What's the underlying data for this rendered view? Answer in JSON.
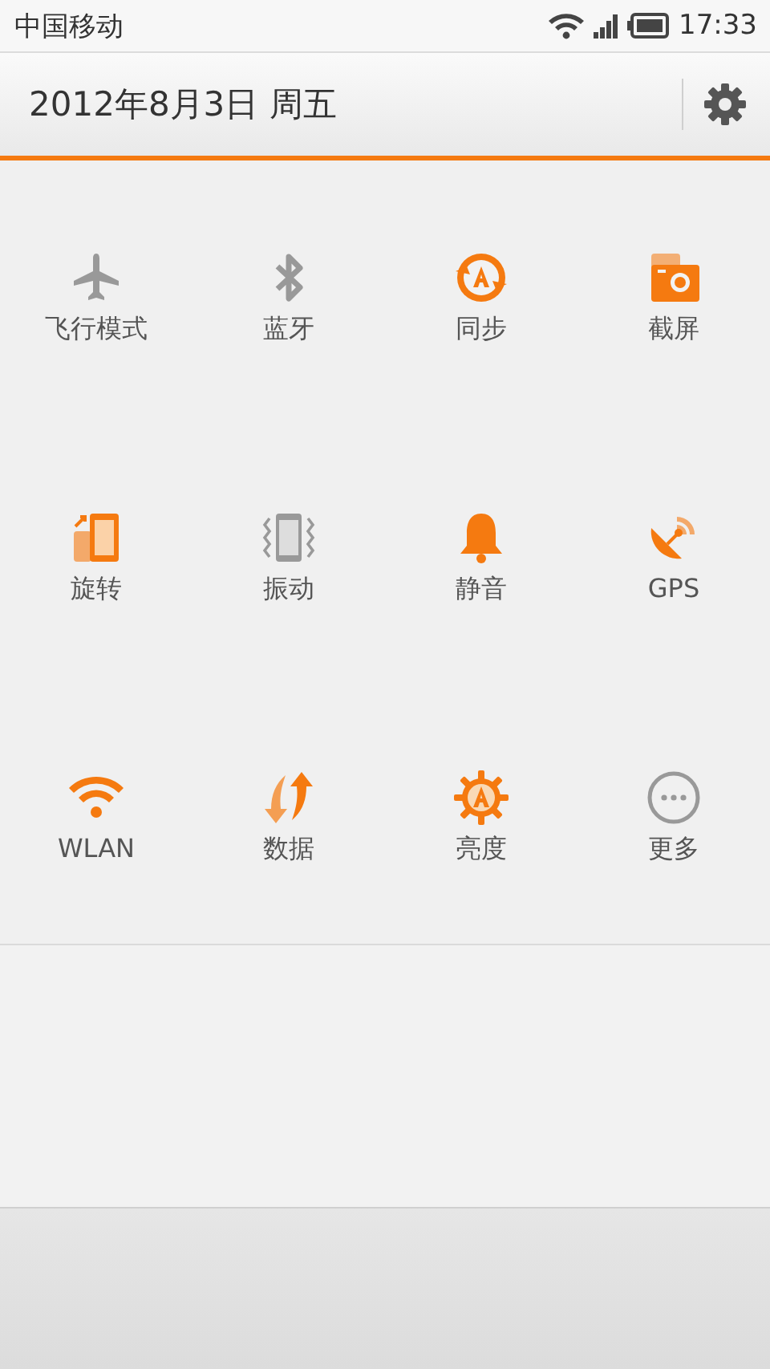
{
  "status_bar": {
    "carrier": "中国移动",
    "time": "17:33"
  },
  "header": {
    "date": "2012年8月3日 周五"
  },
  "toggles": [
    {
      "label": "飞行模式",
      "on": false
    },
    {
      "label": "蓝牙",
      "on": false
    },
    {
      "label": "同步",
      "on": true
    },
    {
      "label": "截屏",
      "on": true
    },
    {
      "label": "旋转",
      "on": true
    },
    {
      "label": "振动",
      "on": false
    },
    {
      "label": "静音",
      "on": true
    },
    {
      "label": "GPS",
      "on": true
    },
    {
      "label": "WLAN",
      "on": true
    },
    {
      "label": "数据",
      "on": true
    },
    {
      "label": "亮度",
      "on": true
    },
    {
      "label": "更多",
      "on": false
    }
  ]
}
